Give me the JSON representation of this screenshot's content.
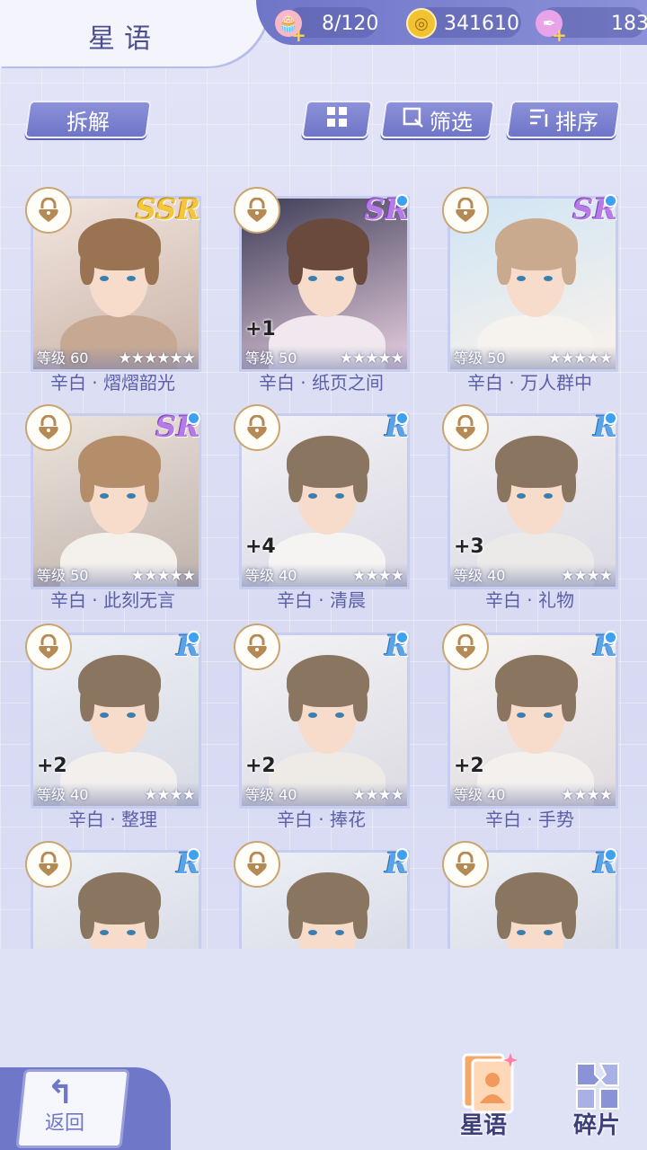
{
  "header": {
    "title": "星语",
    "resources": [
      {
        "icon": "cake-icon",
        "value": "8/120"
      },
      {
        "icon": "coin-icon",
        "value": "341610"
      },
      {
        "icon": "pen-icon",
        "value": "183"
      }
    ]
  },
  "toolbar": {
    "disassemble_label": "拆解",
    "grid_icon": "grid-view-icon",
    "filter_label": "筛选",
    "sort_label": "排序"
  },
  "cards": [
    {
      "name": "辛白 · 熠熠韶光",
      "level": "等级 60",
      "stars": "★★★★★★",
      "rarity": "SSR",
      "plus": ""
    },
    {
      "name": "辛白 · 纸页之间",
      "level": "等级 50",
      "stars": "★★★★★",
      "rarity": "SR",
      "plus": "+1"
    },
    {
      "name": "辛白 · 万人群中",
      "level": "等级 50",
      "stars": "★★★★★",
      "rarity": "SR",
      "plus": ""
    },
    {
      "name": "辛白 · 此刻无言",
      "level": "等级 50",
      "stars": "★★★★★",
      "rarity": "SR",
      "plus": ""
    },
    {
      "name": "辛白 · 清晨",
      "level": "等级 40",
      "stars": "★★★★",
      "rarity": "R",
      "plus": "+4"
    },
    {
      "name": "辛白 · 礼物",
      "level": "等级 40",
      "stars": "★★★★",
      "rarity": "R",
      "plus": "+3"
    },
    {
      "name": "辛白 · 整理",
      "level": "等级 40",
      "stars": "★★★★",
      "rarity": "R",
      "plus": "+2"
    },
    {
      "name": "辛白 · 捧花",
      "level": "等级 40",
      "stars": "★★★★",
      "rarity": "R",
      "plus": "+2"
    },
    {
      "name": "辛白 · 手势",
      "level": "等级 40",
      "stars": "★★★★",
      "rarity": "R",
      "plus": "+2"
    },
    {
      "name": "",
      "level": "",
      "stars": "",
      "rarity": "R",
      "plus": ""
    },
    {
      "name": "",
      "level": "",
      "stars": "",
      "rarity": "R",
      "plus": ""
    },
    {
      "name": "",
      "level": "",
      "stars": "",
      "rarity": "R",
      "plus": ""
    }
  ],
  "bottom_nav": {
    "back_label": "返回",
    "star_label": "星语",
    "fragment_label": "碎片"
  },
  "colors": {
    "accent": "#6f77c9",
    "ssr": "#f4c63d",
    "sr": "#b67be6",
    "r": "#5aa3e8"
  }
}
